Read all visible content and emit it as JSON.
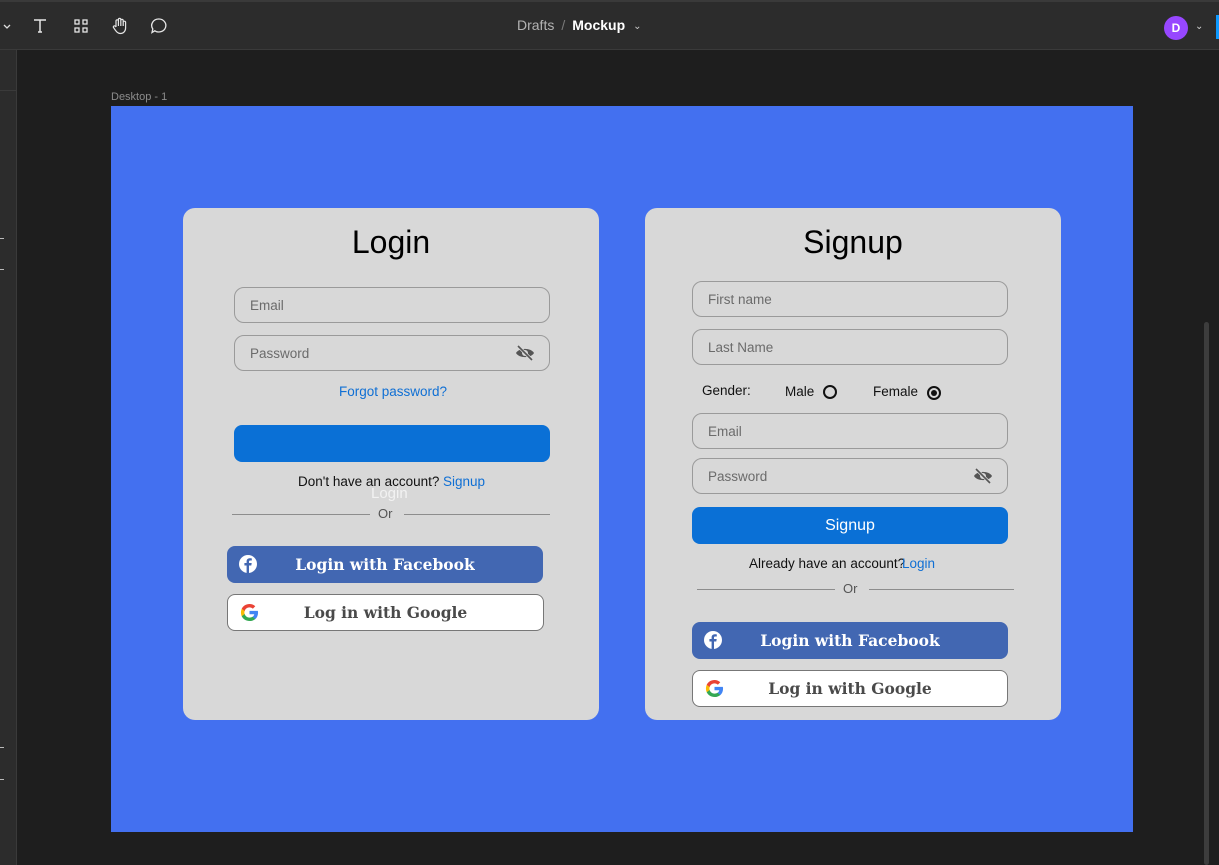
{
  "toolbar": {
    "breadcrumb_parent": "Drafts",
    "breadcrumb_separator": "/",
    "breadcrumb_current": "Mockup",
    "avatar_initial": "D",
    "tools": [
      "text-tool-icon",
      "components-icon",
      "hand-tool-icon",
      "comment-icon"
    ]
  },
  "canvas": {
    "frame_label": "Desktop - 1",
    "frame_color": "#4370f0"
  },
  "login": {
    "title": "Login",
    "email_placeholder": "Email",
    "password_placeholder": "Password",
    "forgot_link": "Forgot password?",
    "button_label": "Login",
    "no_account_text": "Don't have an account?",
    "signup_link": "Signup",
    "or_text": "Or",
    "facebook_label": "Login with Facebook",
    "google_label": "Log in with Google"
  },
  "signup": {
    "title": "Signup",
    "first_name_placeholder": "First name",
    "last_name_placeholder": "Last Name",
    "gender_label": "Gender:",
    "gender_options": [
      "Male",
      "Female"
    ],
    "gender_selected": "Female",
    "email_placeholder": "Email",
    "password_placeholder": "Password",
    "button_label": "Signup",
    "have_account_text": "Already have an account?",
    "login_link": "Login",
    "or_text": "Or",
    "facebook_label": "Login with Facebook",
    "google_label": "Log in with Google"
  },
  "colors": {
    "card_bg": "#d8d8d8",
    "primary_button": "#0a70d6",
    "facebook": "#4267b2",
    "link": "#0f6fd4",
    "avatar": "#9747ff"
  }
}
